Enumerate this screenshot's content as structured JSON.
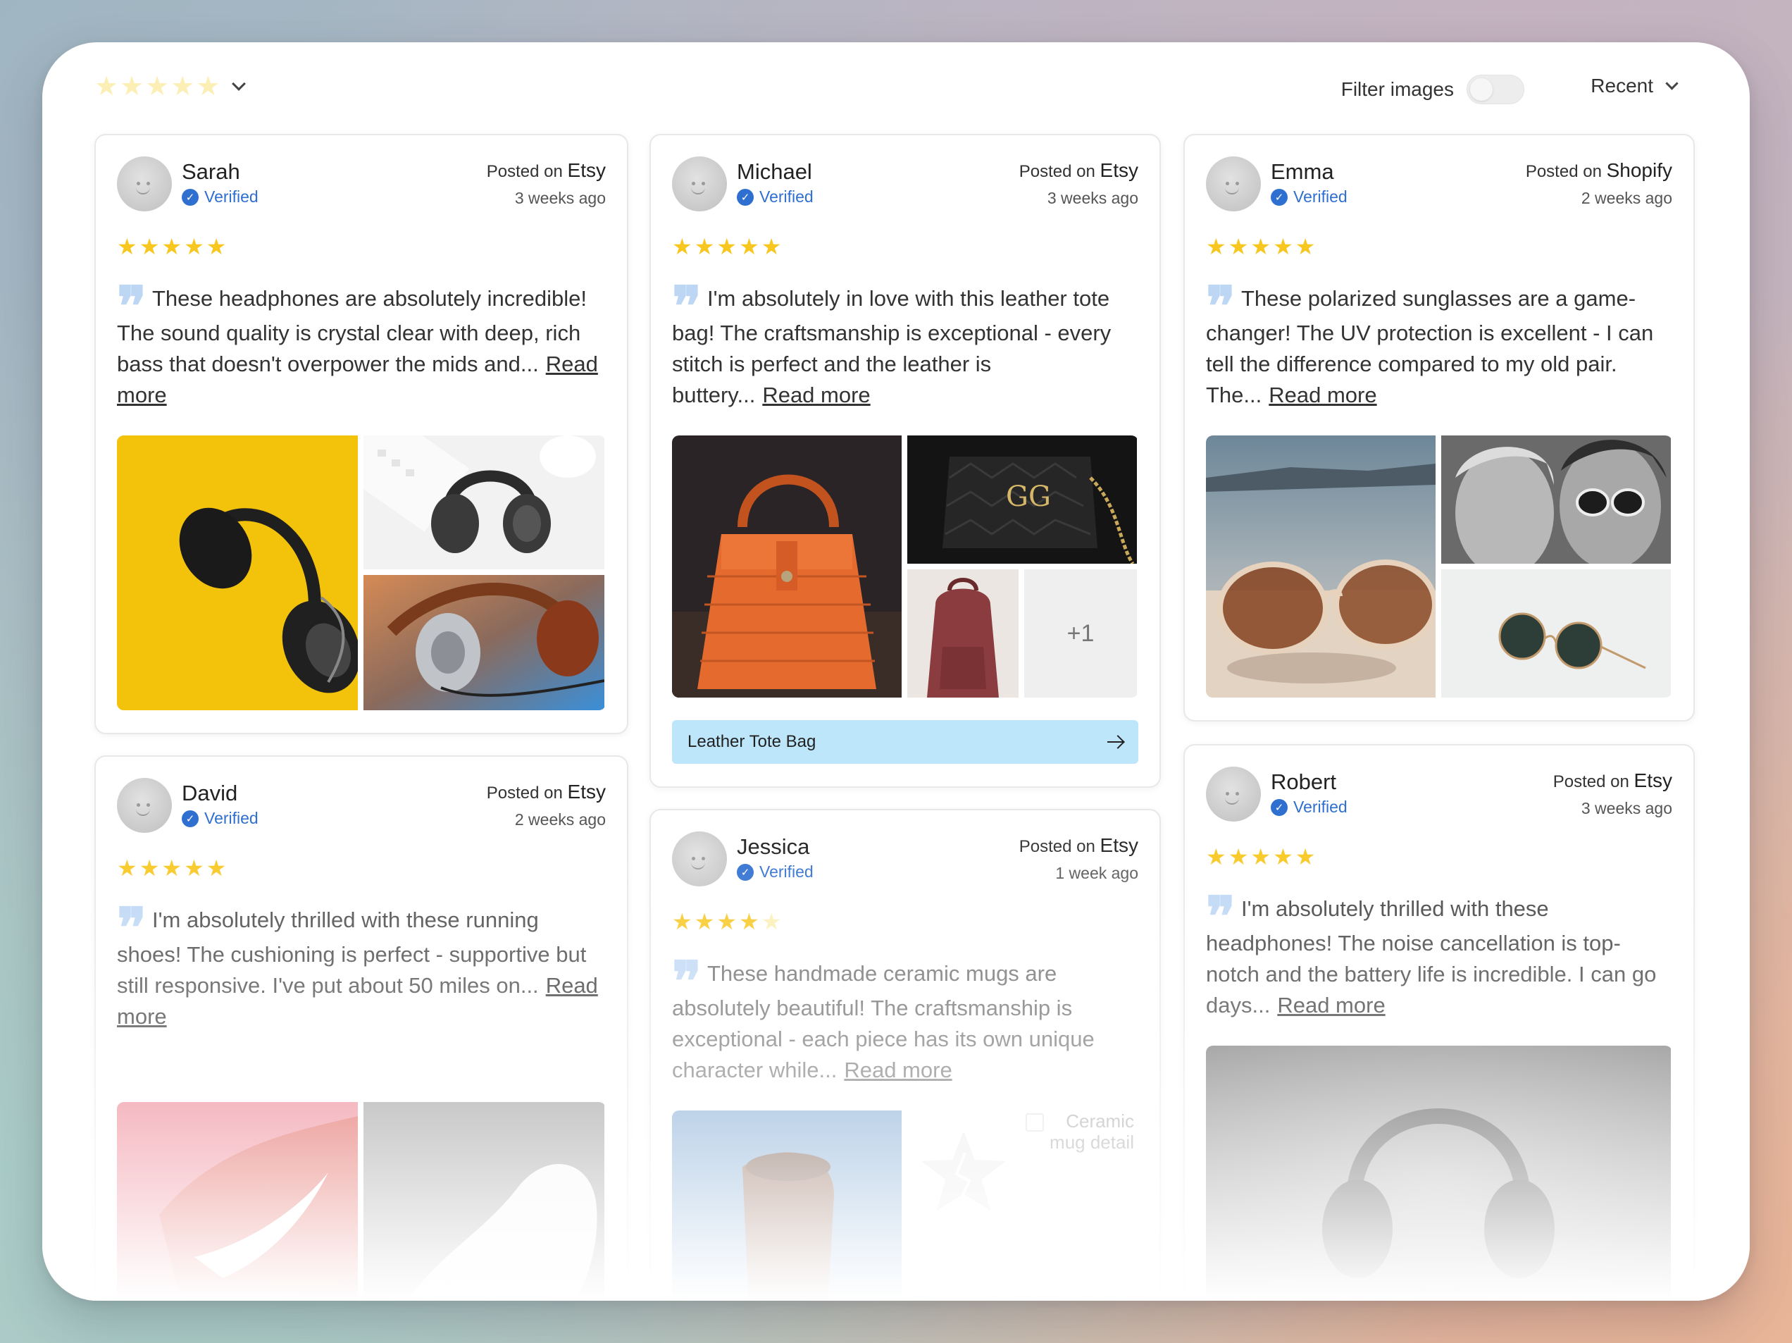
{
  "toolbar": {
    "rating_filter_stars": 5,
    "filter_images_label": "Filter images",
    "filter_images_on": false,
    "sort_label": "Recent"
  },
  "colors": {
    "star_on": "#f8c71f",
    "star_off": "#fbeeb3",
    "verified": "#2f6fd0",
    "quote": "#bcd6f4",
    "product_bar": "#bde6fa"
  },
  "posted_prefix": "Posted on",
  "verified_label": "Verified",
  "read_more_label": "Read more",
  "reviews": [
    {
      "name": "Sarah",
      "platform": "Etsy",
      "ago": "3 weeks ago",
      "rating": 5,
      "text": "These headphones are absolutely incredible! The sound quality is crystal clear with deep, rich bass that doesn't overpower the mids and...",
      "images": [
        "headphones-yellow",
        "headphones-white-desk",
        "headphones-silver-brown"
      ]
    },
    {
      "name": "Michael",
      "platform": "Etsy",
      "ago": "3 weeks ago",
      "rating": 5,
      "text": "I'm absolutely in love with this leather tote bag! The craftsmanship is exceptional - every stitch is perfect and the leather is buttery...",
      "images": [
        "orange-wicker-bag",
        "black-quilted-bag",
        "burgundy-backpack"
      ],
      "more_images": "+1",
      "product": "Leather Tote Bag"
    },
    {
      "name": "Emma",
      "platform": "Shopify",
      "ago": "2 weeks ago",
      "rating": 5,
      "text": "These polarized sunglasses are a game-changer! The UV protection is excellent - I can tell the difference compared to my old pair. The...",
      "images": [
        "sunglasses-beach",
        "women-sunglasses-bw",
        "round-sunglasses"
      ]
    },
    {
      "name": "David",
      "platform": "Etsy",
      "ago": "2 weeks ago",
      "rating": 5,
      "text": "I'm absolutely thrilled with these running shoes! The cushioning is perfect - supportive but still responsive. I've put about 50 miles on...",
      "images": [
        "red-running-shoe",
        "white-sneaker"
      ]
    },
    {
      "name": "Jessica",
      "platform": "Etsy",
      "ago": "1 week ago",
      "rating": 4,
      "text": "These handmade ceramic mugs are absolutely beautiful! The craftsmanship is exceptional - each piece has its own unique character while...",
      "images": [
        "ceramic-mug",
        "broken-image-placeholder"
      ],
      "broken_image_alt": "Ceramic mug detail"
    },
    {
      "name": "Robert",
      "platform": "Etsy",
      "ago": "3 weeks ago",
      "rating": 5,
      "text": "I'm absolutely thrilled with these headphones! The noise cancellation is top-notch and the battery life is incredible. I can go days...",
      "images": [
        "headphones-grey"
      ]
    }
  ]
}
